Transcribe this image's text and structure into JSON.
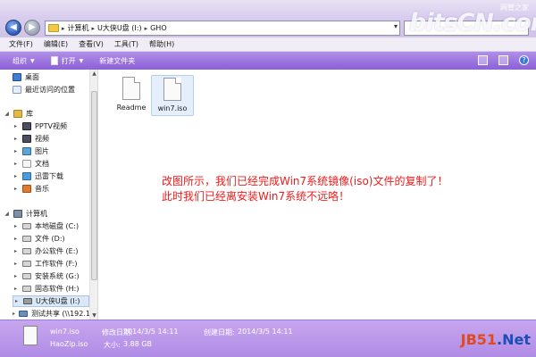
{
  "window": {
    "breadcrumbs": [
      "计算机",
      "U大侠U盘 (I:)",
      "GHO"
    ],
    "address_dropdown": "▾"
  },
  "watermark": {
    "brand": "bitsCN.com",
    "tag": "网管之家"
  },
  "menubar": {
    "items": [
      "文件(F)",
      "编辑(E)",
      "查看(V)",
      "工具(T)",
      "帮助(H)"
    ]
  },
  "toolbar": {
    "organize": "组织",
    "open": "打开",
    "new_folder": "新建文件夹"
  },
  "sidebar": {
    "favorites": [
      {
        "label": "桌面",
        "icon": "desktop-icon"
      },
      {
        "label": "最近访问的位置",
        "icon": "recent-places-icon"
      }
    ],
    "library": {
      "label": "库",
      "icon": "library-icon"
    },
    "library_items": [
      {
        "label": "PPTV视频",
        "icon": "video-icon"
      },
      {
        "label": "视频",
        "icon": "video-icon"
      },
      {
        "label": "图片",
        "icon": "picture-icon"
      },
      {
        "label": "文档",
        "icon": "document-icon"
      },
      {
        "label": "迅雷下载",
        "icon": "thunder-icon"
      },
      {
        "label": "音乐",
        "icon": "music-icon"
      }
    ],
    "computer": {
      "label": "计算机",
      "icon": "computer-icon"
    },
    "drives": [
      {
        "label": "本地磁盘 (C:)",
        "icon": "drive-icon"
      },
      {
        "label": "文件 (D:)",
        "icon": "drive-icon"
      },
      {
        "label": "办公软件 (E:)",
        "icon": "drive-icon"
      },
      {
        "label": "工作软件 (F:)",
        "icon": "drive-icon"
      },
      {
        "label": "安装系统 (G:)",
        "icon": "drive-icon"
      },
      {
        "label": "固态软件 (H:)",
        "icon": "drive-icon"
      },
      {
        "label": "U大侠U盘 (I:)",
        "icon": "usb-drive-icon"
      },
      {
        "label": "测试共享 (\\\\192.1",
        "icon": "network-drive-icon"
      }
    ]
  },
  "files": [
    {
      "name": "Readme",
      "icon": "file-icon"
    },
    {
      "name": "win7.iso",
      "icon": "iso-file-icon"
    }
  ],
  "message": {
    "line1": "改图所示，我们已经完成Win7系统镜像(iso)文件的复制了！",
    "line2": "此时我们已经离安装Win7系统不远咯！"
  },
  "details": {
    "filename": "win7.iso",
    "app": "HaoZip.iso",
    "modified_label": "修改日期:",
    "modified_value": "2014/3/5 14:11",
    "created_label": "创建日期:",
    "created_value": "2014/3/5 14:11",
    "size_label": "大小:",
    "size_value": "3.88 GB"
  },
  "corner_logo": {
    "left": "JB51",
    "right": ".Net"
  },
  "colors": {
    "toolbar": "#9a72de",
    "message": "#ee1b1b",
    "details": "#b08ce6"
  }
}
